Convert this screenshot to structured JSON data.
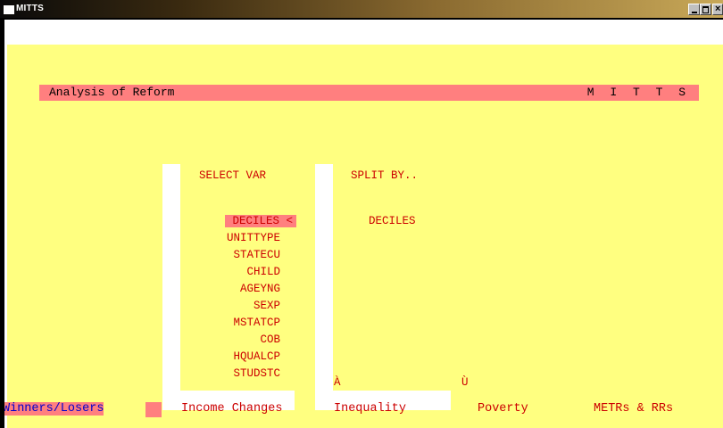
{
  "window": {
    "title": "MITTS"
  },
  "header": {
    "title": "Analysis of Reform",
    "brand": "M I T T S"
  },
  "select_panel": {
    "title": "SELECT VAR",
    "items": [
      {
        "label": "DECILES <",
        "selected": true
      },
      {
        "label": "UNITTYPE"
      },
      {
        "label": "STATECU"
      },
      {
        "label": "CHILD"
      },
      {
        "label": "AGEYNG"
      },
      {
        "label": "SEXP"
      },
      {
        "label": "MSTATCP"
      },
      {
        "label": "COB"
      },
      {
        "label": "HQUALCP"
      },
      {
        "label": "STUDSTC"
      }
    ]
  },
  "split_panel": {
    "title": "SPLIT BY..",
    "value": "DECILES",
    "glyph_left": "À",
    "glyph_right": "Ù"
  },
  "tabs": [
    {
      "label": "Winners/Losers",
      "active": true
    },
    {
      "label": "Income Changes"
    },
    {
      "label": "Inequality"
    },
    {
      "label": "Poverty"
    },
    {
      "label": "METRs & RRs"
    }
  ],
  "colors": {
    "background": "#ffff80",
    "highlight": "#ff7f7f",
    "text": "#cc0000",
    "active_tab_text": "#0000cc"
  }
}
